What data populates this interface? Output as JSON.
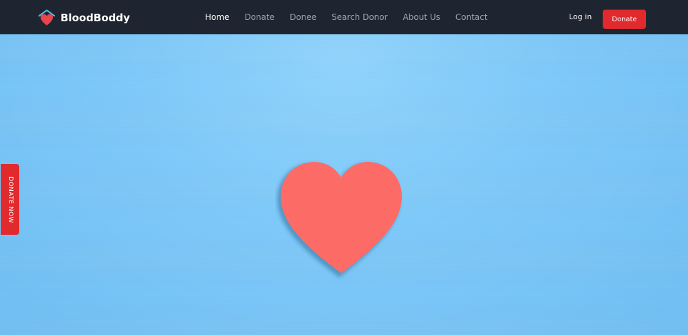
{
  "brand": {
    "name": "BloodBoddy",
    "logo_icon": "heart-house-icon"
  },
  "nav": {
    "items": [
      {
        "label": "Home",
        "active": true
      },
      {
        "label": "Donate",
        "active": false
      },
      {
        "label": "Donee",
        "active": false
      },
      {
        "label": "Search Donor",
        "active": false
      },
      {
        "label": "About Us",
        "active": false
      },
      {
        "label": "Contact",
        "active": false
      }
    ],
    "login_label": "Log in",
    "donate_label": "Donate"
  },
  "side_tab": {
    "label": "DONATE NOW"
  },
  "hero": {
    "image_icon": "heart-illustration"
  },
  "colors": {
    "navbar_bg": "#1f2530",
    "accent_red": "#e12a2d",
    "hero_blue": "#7ec8f8",
    "heart_coral": "#fd6b67"
  }
}
